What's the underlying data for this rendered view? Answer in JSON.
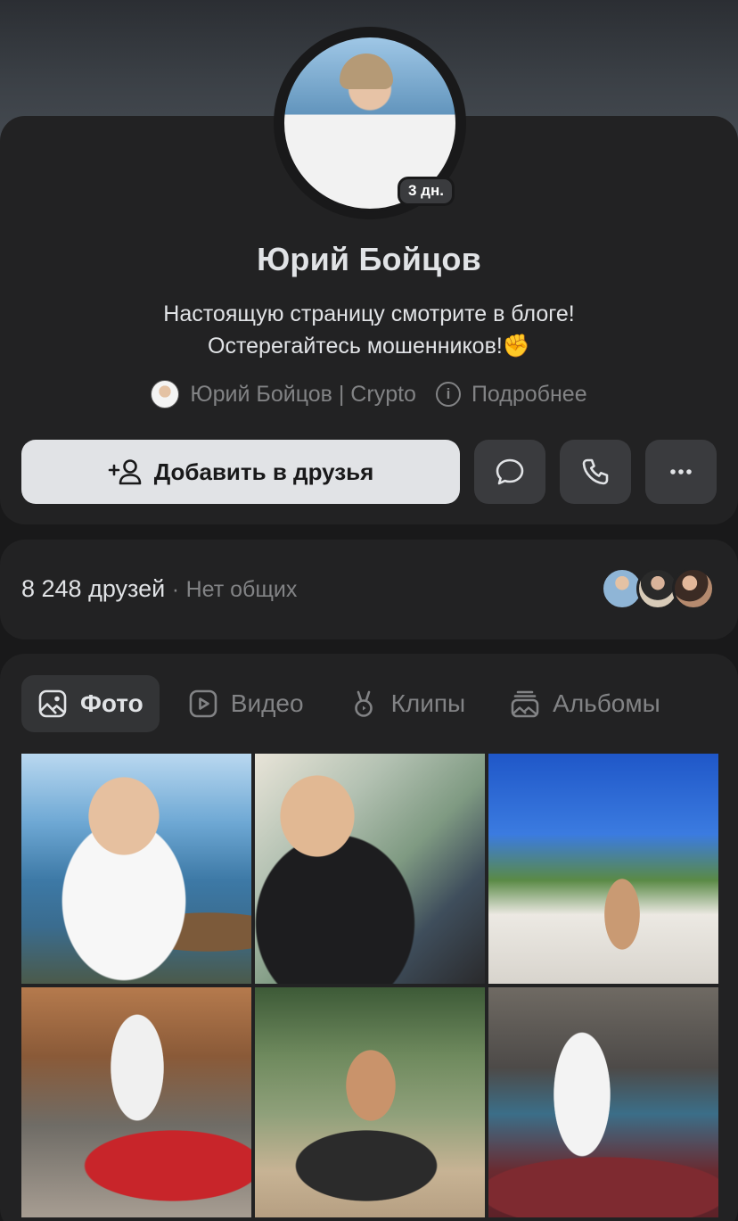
{
  "profile": {
    "name": "Юрий Бойцов",
    "story_badge": "3 дн.",
    "status_line1": "Настоящую страницу смотрите в блоге!",
    "status_line2": "Остерегайтесь мошенников!✊",
    "blog_link": "Юрий Бойцов | Crypto",
    "details_link": "Подробнее"
  },
  "actions": {
    "add_friend_label": "Добавить в друзья",
    "message_icon": "chat-bubble-icon",
    "call_icon": "phone-icon",
    "more_icon": "more-dots-icon"
  },
  "friends": {
    "count_label": "8 248 друзей",
    "separator": "·",
    "mutual_label": "Нет общих",
    "avatar_colors": [
      "#8fb5d6",
      "#d8cbb8",
      "#b58a6e"
    ]
  },
  "media": {
    "tabs": [
      {
        "label": "Фото",
        "icon": "image-icon",
        "active": true
      },
      {
        "label": "Видео",
        "icon": "video-icon",
        "active": false
      },
      {
        "label": "Клипы",
        "icon": "clips-icon",
        "active": false
      },
      {
        "label": "Альбомы",
        "icon": "albums-icon",
        "active": false
      }
    ],
    "photos_count_shown": 6
  },
  "colors": {
    "background": "#19191a",
    "card": "#222223",
    "primary_button": "#e1e3e6",
    "secondary_button": "#3a3b3e",
    "muted_text": "#828385"
  }
}
